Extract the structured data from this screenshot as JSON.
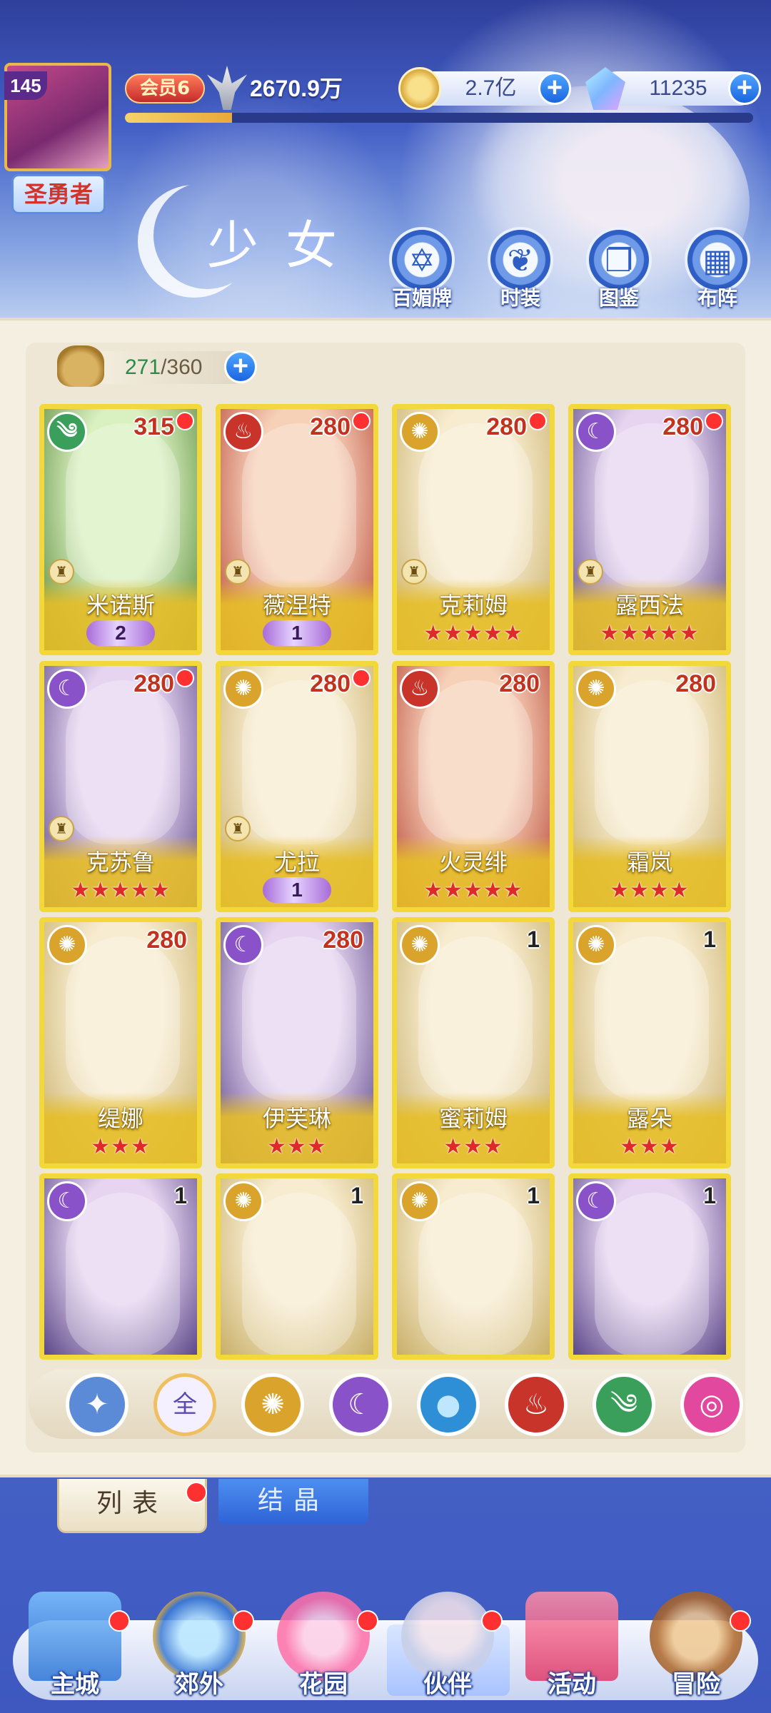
{
  "player": {
    "level": "145",
    "title": "圣勇者",
    "vip": "会员6",
    "power": "2670.9万",
    "xp_progress": 0.17
  },
  "currency": {
    "gold": "2.7亿",
    "gems": "11235"
  },
  "page_title": "少女",
  "top_buttons": [
    {
      "label": "百媚牌",
      "icon": "card-icon"
    },
    {
      "label": "时装",
      "icon": "outfit-icon"
    },
    {
      "label": "图鉴",
      "icon": "book-icon"
    },
    {
      "label": "布阵",
      "icon": "formation-icon"
    }
  ],
  "capacity": {
    "current": "271",
    "max": "/360"
  },
  "cards": [
    {
      "name": "米诺斯",
      "element": "wind",
      "level": "315",
      "red_dot": true,
      "rank": true,
      "bottom": "wing",
      "wing_value": "2"
    },
    {
      "name": "薇涅特",
      "element": "fire",
      "level": "280",
      "red_dot": true,
      "rank": true,
      "bottom": "wing",
      "wing_value": "1"
    },
    {
      "name": "克莉姆",
      "element": "light",
      "level": "280",
      "red_dot": true,
      "rank": true,
      "bottom": "stars",
      "stars": "★★★★★"
    },
    {
      "name": "露西法",
      "element": "dark",
      "level": "280",
      "red_dot": true,
      "rank": true,
      "bottom": "stars",
      "stars": "★★★★★"
    },
    {
      "name": "克苏鲁",
      "element": "dark",
      "level": "280",
      "red_dot": true,
      "rank": true,
      "bottom": "stars",
      "stars": "★★★★★"
    },
    {
      "name": "尤拉",
      "element": "light",
      "level": "280",
      "red_dot": true,
      "rank": true,
      "bottom": "wing",
      "wing_value": "1"
    },
    {
      "name": "火灵绯",
      "element": "fire",
      "level": "280",
      "red_dot": false,
      "rank": false,
      "bottom": "stars",
      "stars": "★★★★★"
    },
    {
      "name": "霜岚",
      "element": "light",
      "level": "280",
      "red_dot": false,
      "rank": false,
      "bottom": "stars",
      "stars": "★★★★"
    },
    {
      "name": "缇娜",
      "element": "light",
      "level": "280",
      "red_dot": false,
      "rank": false,
      "bottom": "stars",
      "stars": "★★★"
    },
    {
      "name": "伊芙琳",
      "element": "dark",
      "level": "280",
      "red_dot": false,
      "rank": false,
      "bottom": "stars",
      "stars": "★★★"
    },
    {
      "name": "蜜莉姆",
      "element": "light",
      "level": "1",
      "red_dot": false,
      "rank": false,
      "bottom": "stars",
      "stars": "★★★"
    },
    {
      "name": "露朵",
      "element": "light",
      "level": "1",
      "red_dot": false,
      "rank": false,
      "bottom": "stars",
      "stars": "★★★"
    },
    {
      "name": "",
      "element": "dark",
      "level": "1",
      "red_dot": false,
      "rank": false,
      "bottom": "none"
    },
    {
      "name": "",
      "element": "light",
      "level": "1",
      "red_dot": false,
      "rank": false,
      "bottom": "none"
    },
    {
      "name": "",
      "element": "light",
      "level": "1",
      "red_dot": false,
      "rank": false,
      "bottom": "none"
    },
    {
      "name": "",
      "element": "dark",
      "level": "1",
      "red_dot": false,
      "rank": false,
      "bottom": "none"
    }
  ],
  "filters": [
    {
      "name": "collapse",
      "label": "",
      "color": "#5b8ad6"
    },
    {
      "name": "all",
      "label": "全",
      "color": "#f4f0ff"
    },
    {
      "name": "light",
      "label": "",
      "color": "#d9a32c"
    },
    {
      "name": "dark",
      "label": "",
      "color": "#8a52c8"
    },
    {
      "name": "water",
      "label": "",
      "color": "#2e8fd6"
    },
    {
      "name": "fire",
      "label": "",
      "color": "#c9342a"
    },
    {
      "name": "wind",
      "label": "",
      "color": "#3a9f5a"
    },
    {
      "name": "special",
      "label": "",
      "color": "#e2489e"
    }
  ],
  "tabs": {
    "list": "列表",
    "crystal": "结晶"
  },
  "nav": [
    {
      "label": "主城",
      "icon": "castle-icon",
      "dot": true
    },
    {
      "label": "郊外",
      "icon": "portal-icon",
      "dot": true
    },
    {
      "label": "花园",
      "icon": "heart-icon",
      "dot": true
    },
    {
      "label": "伙伴",
      "icon": "partner-icon",
      "dot": true,
      "active": true
    },
    {
      "label": "活动",
      "icon": "gift-icon",
      "dot": false
    },
    {
      "label": "冒险",
      "icon": "adventure-icon",
      "dot": true
    }
  ]
}
